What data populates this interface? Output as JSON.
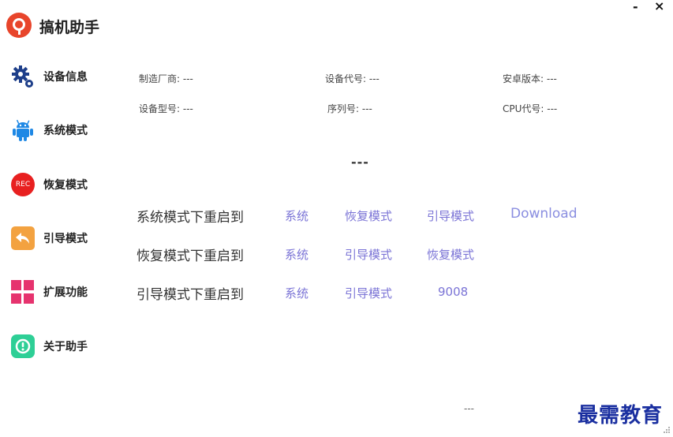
{
  "app": {
    "title": "搞机助手"
  },
  "window": {
    "minimize": "-",
    "close": "×"
  },
  "sidebar": {
    "items": [
      {
        "label": "设备信息",
        "icon": "gear-icon"
      },
      {
        "label": "系统模式",
        "icon": "android-icon"
      },
      {
        "label": "恢复模式",
        "icon": "rec-icon",
        "icon_text": "REC"
      },
      {
        "label": "引导模式",
        "icon": "back-arrow-icon"
      },
      {
        "label": "扩展功能",
        "icon": "grid-icon"
      },
      {
        "label": "关于助手",
        "icon": "info-icon"
      }
    ]
  },
  "device_info": {
    "manufacturer": "制造厂商: ---",
    "device_code": "设备代号: ---",
    "android_version": "安卓版本: ---",
    "device_model": "设备型号: ---",
    "serial": "序列号: ---",
    "cpu_code": "CPU代号: ---"
  },
  "status": "---",
  "reboot": {
    "system_row": {
      "label": "系统模式下重启到",
      "links": [
        "系统",
        "恢复模式",
        "引导模式",
        "Download"
      ]
    },
    "recovery_row": {
      "label": "恢复模式下重启到",
      "links": [
        "系统",
        "引导模式",
        "恢复模式"
      ]
    },
    "bootloader_row": {
      "label": "引导模式下重启到",
      "links": [
        "系统",
        "引导模式",
        "9008"
      ]
    }
  },
  "footer": {
    "status": "---",
    "watermark": "最需教育"
  },
  "colors": {
    "accent_link": "#7b74d6",
    "brand_red": "#e8452b",
    "android_blue": "#1e88e5",
    "rec_red": "#e82020",
    "back_orange": "#f3a240",
    "grid_pink": "#e6336e",
    "info_green": "#2ecf96"
  }
}
